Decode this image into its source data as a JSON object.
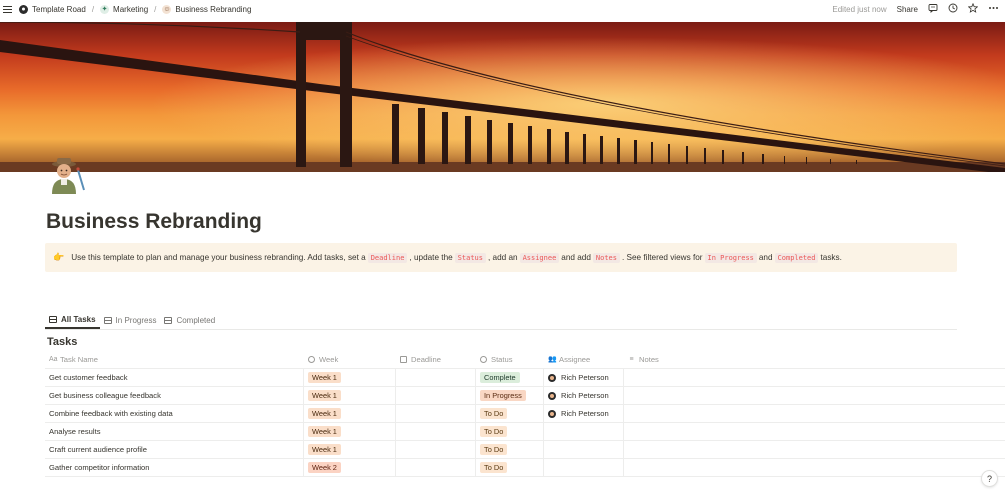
{
  "breadcrumb": [
    {
      "label": "Template Road",
      "icon": "template-road-logo-icon"
    },
    {
      "label": "Marketing",
      "icon": "marketing-icon"
    },
    {
      "label": "Business Rebranding",
      "icon": "explorer-emoji-icon"
    }
  ],
  "topbar": {
    "edited": "Edited just now",
    "share_label": "Share",
    "icons": [
      "comment-icon",
      "clock-icon",
      "star-icon",
      "more-icon"
    ]
  },
  "page": {
    "title": "Business Rebranding",
    "icon": "explorer-emoji-icon"
  },
  "callout": {
    "icon": "pointing-hand-icon",
    "t1": "Use this template to plan and manage your business rebranding. Add tasks, set a",
    "c1": "Deadline",
    "t2": ", update the",
    "c2": "Status",
    "t3": ", add an",
    "c3": "Assignee",
    "t4": "and add",
    "c4": "Notes",
    "t5": ". See filtered views for",
    "c5": "In Progress",
    "t6": "and",
    "c6": "Completed",
    "t7": "tasks."
  },
  "tabs": [
    {
      "label": "All Tasks",
      "active": true
    },
    {
      "label": "In Progress",
      "active": false
    },
    {
      "label": "Completed",
      "active": false
    }
  ],
  "database": {
    "title": "Tasks",
    "columns": {
      "name": "Task Name",
      "week": "Week",
      "deadline": "Deadline",
      "status": "Status",
      "assignee": "Assignee",
      "notes": "Notes"
    },
    "rows": [
      {
        "name": "Get customer feedback",
        "week": "Week 1",
        "deadline": "",
        "status": "Complete",
        "assignee": "Rich Peterson",
        "notes": ""
      },
      {
        "name": "Get business colleague feedback",
        "week": "Week 1",
        "deadline": "",
        "status": "In Progress",
        "assignee": "Rich Peterson",
        "notes": ""
      },
      {
        "name": "Combine feedback with existing data",
        "week": "Week 1",
        "deadline": "",
        "status": "To Do",
        "assignee": "Rich Peterson",
        "notes": ""
      },
      {
        "name": "Analyse results",
        "week": "Week 1",
        "deadline": "",
        "status": "To Do",
        "assignee": "",
        "notes": ""
      },
      {
        "name": "Craft current audience profile",
        "week": "Week 1",
        "deadline": "",
        "status": "To Do",
        "assignee": "",
        "notes": ""
      },
      {
        "name": "Gather competitor information",
        "week": "Week 2",
        "deadline": "",
        "status": "To Do",
        "assignee": "",
        "notes": ""
      }
    ]
  },
  "help_label": "?"
}
